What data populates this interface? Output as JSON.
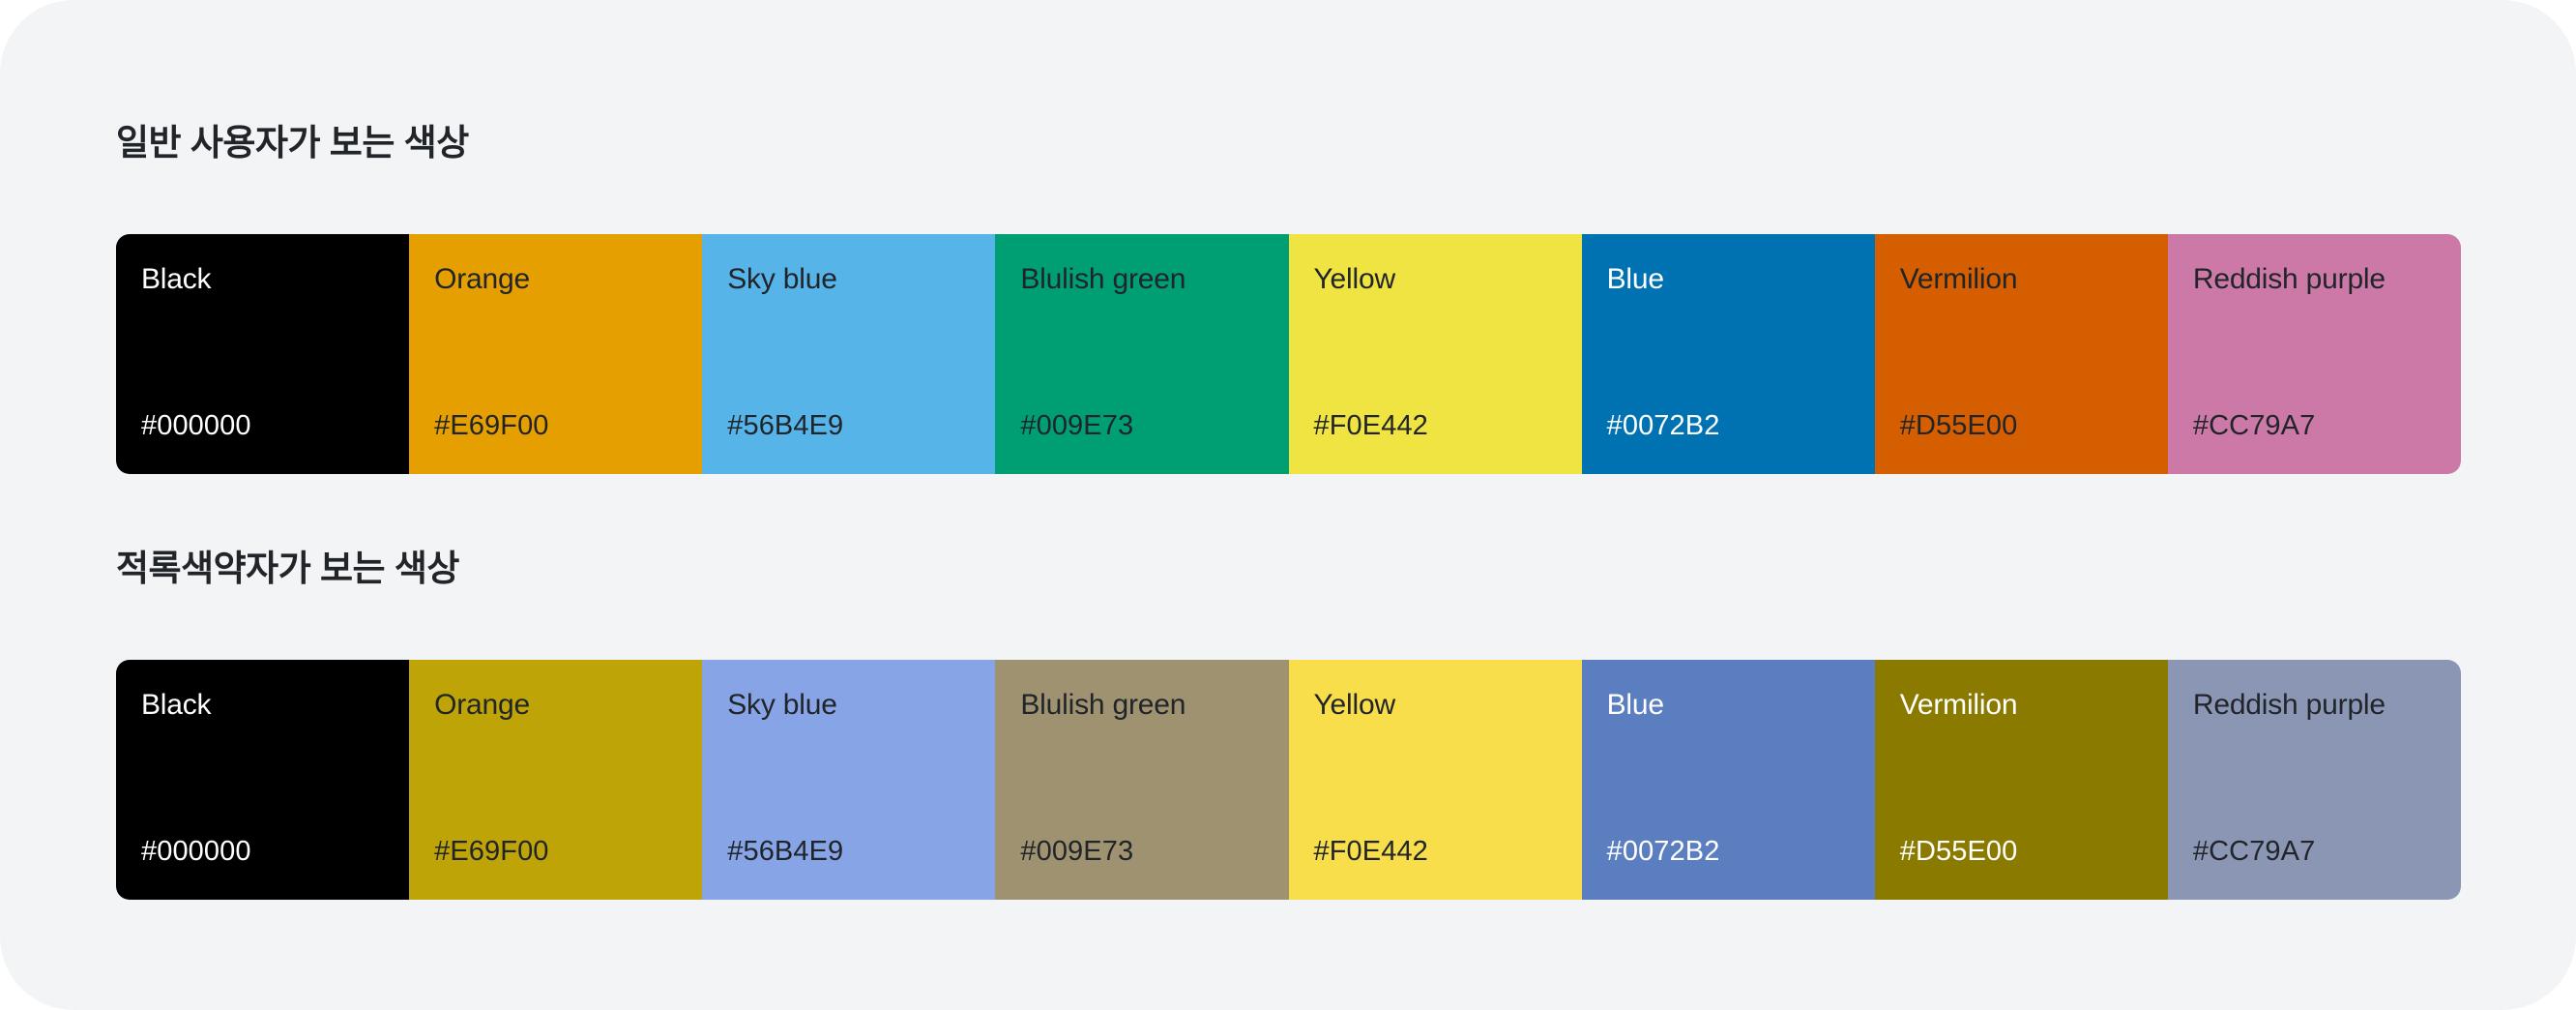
{
  "page": {
    "background": "#F2F4F6",
    "text_dark": "#212529",
    "text_light": "#FFFFFF"
  },
  "sections": [
    {
      "id": "normal-vision",
      "heading": "일반 사용자가 보는 색상",
      "swatches": [
        {
          "name": "Black",
          "hex": "#000000",
          "swatch_color": "#000000",
          "text_color": "#FFFFFF"
        },
        {
          "name": "Orange",
          "hex": "#E69F00",
          "swatch_color": "#E69F00",
          "text_color": "#212529"
        },
        {
          "name": "Sky blue",
          "hex": "#56B4E9",
          "swatch_color": "#56B4E9",
          "text_color": "#212529"
        },
        {
          "name": "Blulish green",
          "hex": "#009E73",
          "swatch_color": "#009E73",
          "text_color": "#212529"
        },
        {
          "name": "Yellow",
          "hex": "#F0E442",
          "swatch_color": "#F0E442",
          "text_color": "#212529"
        },
        {
          "name": "Blue",
          "hex": "#0072B2",
          "swatch_color": "#0072B2",
          "text_color": "#FFFFFF"
        },
        {
          "name": "Vermilion",
          "hex": "#D55E00",
          "swatch_color": "#D55E00",
          "text_color": "#212529"
        },
        {
          "name": "Reddish purple",
          "hex": "#CC79A7",
          "swatch_color": "#CC79A7",
          "text_color": "#212529"
        }
      ]
    },
    {
      "id": "deuteranopia-vision",
      "heading": "적록색약자가 보는 색상",
      "swatches": [
        {
          "name": "Black",
          "hex": "#000000",
          "swatch_color": "#000000",
          "text_color": "#FFFFFF"
        },
        {
          "name": "Orange",
          "hex": "#E69F00",
          "swatch_color": "#BFA408",
          "text_color": "#212529"
        },
        {
          "name": "Sky blue",
          "hex": "#56B4E9",
          "swatch_color": "#87A4E6",
          "text_color": "#212529"
        },
        {
          "name": "Blulish green",
          "hex": "#009E73",
          "swatch_color": "#9E9270",
          "text_color": "#212529"
        },
        {
          "name": "Yellow",
          "hex": "#F0E442",
          "swatch_color": "#F8DE4A",
          "text_color": "#212529"
        },
        {
          "name": "Blue",
          "hex": "#0072B2",
          "swatch_color": "#5B7EC0",
          "text_color": "#FFFFFF"
        },
        {
          "name": "Vermilion",
          "hex": "#D55E00",
          "swatch_color": "#8B7A00",
          "text_color": "#FFFFFF"
        },
        {
          "name": "Reddish purple",
          "hex": "#CC79A7",
          "swatch_color": "#8B96B5",
          "text_color": "#212529"
        }
      ]
    }
  ]
}
